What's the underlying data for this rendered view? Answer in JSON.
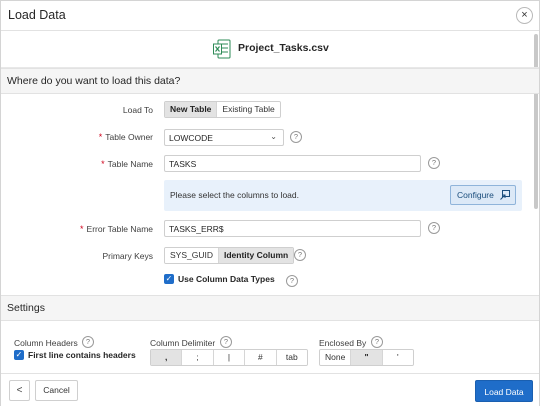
{
  "dialog": {
    "title": "Load Data",
    "close_label": "×"
  },
  "file": {
    "name": "Project_Tasks.csv",
    "icon": "excel-file-icon"
  },
  "section1": {
    "title": "Where do you want to load this data?"
  },
  "load_to": {
    "label": "Load To",
    "options": [
      "New Table",
      "Existing Table"
    ],
    "selected": "New Table"
  },
  "table_owner": {
    "label": "Table Owner",
    "value": "LOWCODE",
    "required": true
  },
  "table_name": {
    "label": "Table Name",
    "value": "TASKS",
    "required": true
  },
  "columns_info": {
    "message": "Please select the columns to load.",
    "button": "Configure"
  },
  "error_table": {
    "label": "Error Table Name",
    "value": "TASKS_ERR$",
    "required": true
  },
  "primary_keys": {
    "label": "Primary Keys",
    "options": [
      "SYS_GUID",
      "Identity Column"
    ],
    "selected": "Identity Column"
  },
  "use_types": {
    "label": "Use Column Data Types",
    "checked": true
  },
  "section2": {
    "title": "Settings"
  },
  "settings": {
    "column_headers": {
      "label": "Column Headers",
      "checkbox_label": "First line contains headers",
      "checked": true
    },
    "delimiter": {
      "label": "Column Delimiter",
      "options": [
        ",",
        ";",
        "|",
        "#",
        "tab"
      ],
      "selected": ","
    },
    "enclosed": {
      "label": "Enclosed By",
      "options": [
        "None",
        "\"",
        "'"
      ],
      "selected": "\""
    }
  },
  "footer": {
    "back_label": "<",
    "cancel_label": "Cancel",
    "primary_label": "Load Data"
  },
  "help_glyph": "?",
  "required_mark": "*",
  "colors": {
    "accent": "#1f6dc9",
    "required": "#d0021b",
    "info_bg": "#e8f1fb"
  }
}
